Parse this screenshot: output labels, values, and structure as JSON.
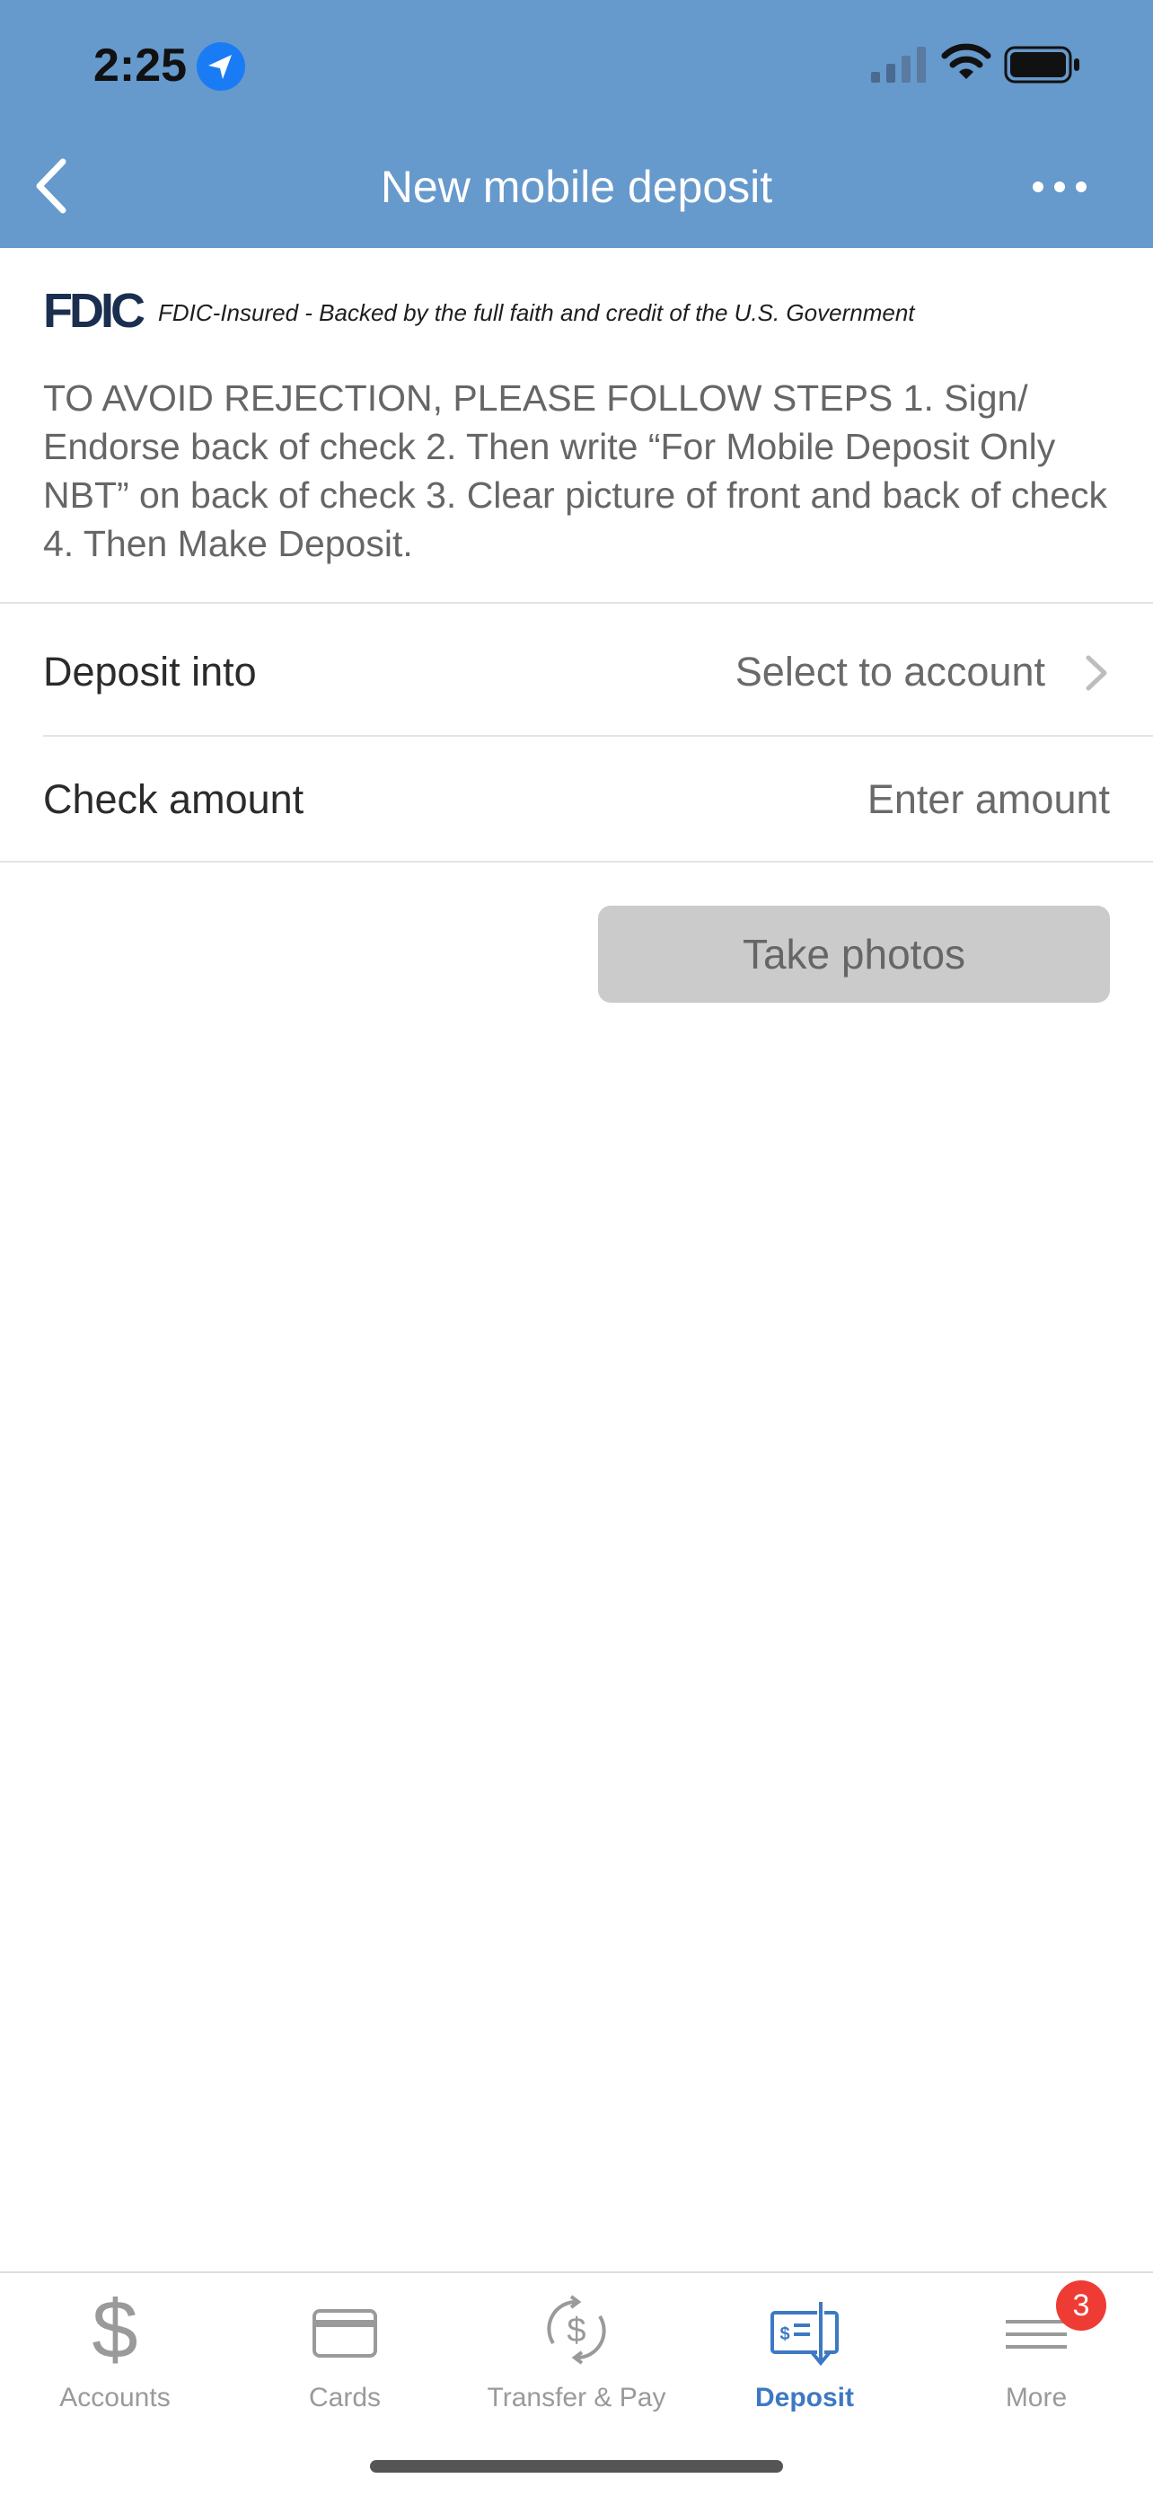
{
  "status_bar": {
    "time": "2:25"
  },
  "nav": {
    "title": "New mobile deposit"
  },
  "fdic": {
    "logo": "FDIC",
    "text": "FDIC-Insured - Backed by the full faith and credit of the U.S. Government"
  },
  "instructions": "TO AVOID REJECTION, PLEASE FOLLOW STEPS 1. Sign/ Endorse back of check 2. Then write “For Mobile Deposit Only NBT” on back of check 3. Clear picture of front and back of check 4. Then Make Deposit.",
  "form": {
    "deposit_into_label": "Deposit into",
    "deposit_into_value": "Select to account",
    "check_amount_label": "Check amount",
    "check_amount_placeholder": "Enter amount"
  },
  "take_photos_label": "Take photos",
  "tabs": [
    {
      "label": "Accounts",
      "icon": "dollar-icon"
    },
    {
      "label": "Cards",
      "icon": "card-icon"
    },
    {
      "label": "Transfer & Pay",
      "icon": "transfer-icon"
    },
    {
      "label": "Deposit",
      "icon": "check-deposit-icon",
      "active": true
    },
    {
      "label": "More",
      "icon": "menu-icon",
      "badge": "3"
    }
  ],
  "colors": {
    "header": "#6699cc",
    "active_tab": "#3d79c2",
    "badge": "#ee3b33",
    "button_disabled": "#cbcbcb"
  }
}
